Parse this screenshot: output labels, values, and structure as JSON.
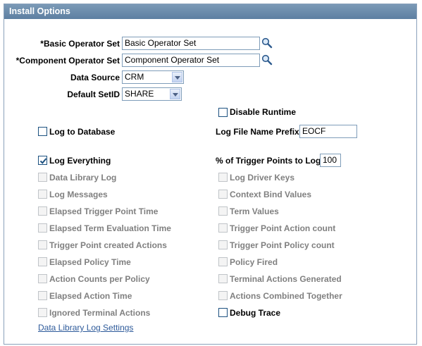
{
  "panel": {
    "title": "Install Options"
  },
  "fields": {
    "basic_operator_set": {
      "label": "*Basic Operator Set",
      "value": "Basic Operator Set"
    },
    "component_operator_set": {
      "label": "*Component Operator Set",
      "value": "Component Operator Set"
    },
    "data_source": {
      "label": "Data Source",
      "value": "CRM"
    },
    "default_setid": {
      "label": "Default SetID",
      "value": "SHARE"
    },
    "log_file_name_prefix": {
      "label": "Log File Name Prefix",
      "value": "EOCF"
    },
    "trigger_points_pct": {
      "label": "% of Trigger Points to Log",
      "value": "100"
    }
  },
  "checkboxes": {
    "disable_runtime": {
      "label": "Disable Runtime",
      "checked": false,
      "enabled": true
    },
    "log_to_database": {
      "label": "Log to Database",
      "checked": false,
      "enabled": true
    },
    "log_everything": {
      "label": "Log Everything",
      "checked": true,
      "enabled": true
    },
    "data_library_log": {
      "label": "Data Library Log",
      "checked": false,
      "enabled": false
    },
    "log_messages": {
      "label": "Log Messages",
      "checked": false,
      "enabled": false
    },
    "elapsed_trigger_point_time": {
      "label": "Elapsed Trigger Point Time",
      "checked": false,
      "enabled": false
    },
    "elapsed_term_evaluation_time": {
      "label": "Elapsed Term Evaluation Time",
      "checked": false,
      "enabled": false
    },
    "trigger_point_created_actions": {
      "label": "Trigger Point created Actions",
      "checked": false,
      "enabled": false
    },
    "elapsed_policy_time": {
      "label": "Elapsed Policy Time",
      "checked": false,
      "enabled": false
    },
    "action_counts_per_policy": {
      "label": "Action Counts per Policy",
      "checked": false,
      "enabled": false
    },
    "elapsed_action_time": {
      "label": "Elapsed Action Time",
      "checked": false,
      "enabled": false
    },
    "ignored_terminal_actions": {
      "label": "Ignored Terminal Actions",
      "checked": false,
      "enabled": false
    },
    "log_driver_keys": {
      "label": "Log Driver Keys",
      "checked": false,
      "enabled": false
    },
    "context_bind_values": {
      "label": "Context Bind Values",
      "checked": false,
      "enabled": false
    },
    "term_values": {
      "label": "Term Values",
      "checked": false,
      "enabled": false
    },
    "trigger_point_action_count": {
      "label": "Trigger Point Action count",
      "checked": false,
      "enabled": false
    },
    "trigger_point_policy_count": {
      "label": "Trigger Point Policy count",
      "checked": false,
      "enabled": false
    },
    "policy_fired": {
      "label": "Policy Fired",
      "checked": false,
      "enabled": false
    },
    "terminal_actions_generated": {
      "label": "Terminal Actions Generated",
      "checked": false,
      "enabled": false
    },
    "actions_combined_together": {
      "label": "Actions Combined Together",
      "checked": false,
      "enabled": false
    },
    "debug_trace": {
      "label": "Debug Trace",
      "checked": false,
      "enabled": true
    }
  },
  "links": {
    "data_library_log_settings": "Data Library Log Settings"
  },
  "icons": {
    "lookup": "magnifying-glass-icon",
    "dropdown": "chevron-down-icon"
  }
}
